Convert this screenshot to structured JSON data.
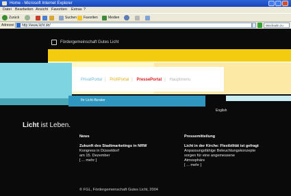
{
  "browser": {
    "title": "Home - Microsoft Internet Explorer",
    "menu": [
      "Datei",
      "Bearbeiten",
      "Ansicht",
      "Favoriten",
      "Extras",
      "?"
    ],
    "toolbar": {
      "back": "Zurück",
      "search": "Suchen",
      "favorites": "Favoriten",
      "media": "Medien"
    },
    "address_label": "Adresse",
    "url": "http://www.licht.de/",
    "search_box": "Wechseln zu"
  },
  "site": {
    "org_name": "Fördergemeinschaft Gutes Licht",
    "portals": [
      {
        "label": "PrivatPortal"
      },
      {
        "label": "ProfiPortal"
      },
      {
        "label": "PressePortal"
      },
      {
        "label": "Hauptmenu"
      }
    ],
    "separator": "|",
    "berater": "Ihr Licht-Berater",
    "english": "English",
    "tagline_bold": "Licht",
    "tagline_rest": " ist Leben.",
    "news": {
      "heading": "News",
      "title": "Zukunft des Stadtmarketings in NRW",
      "lines": [
        "Kongress in Düsseldorf",
        "am 15. Dezember",
        "[ ... mehr ]"
      ]
    },
    "press": {
      "heading": "Pressemitteilung",
      "title": "Licht in der Kirche: Flexibilität ist gefragt",
      "lines": [
        "Anpassungsfähige Beleuchtungskonzepte",
        "sorgen für eine angemessene",
        "Atmosphäre",
        "[ ... mehr ]"
      ]
    },
    "copyright": "© FGL, Fördergemeinschaft Gutes Licht, 2004"
  },
  "colors": {
    "background": "#0a0a0a",
    "yellow": "#f3cc10",
    "cream": "#fff7c8",
    "cyan": "#7ed4e0",
    "blue": "#2f97bf",
    "presse_red": "#e21a1a"
  }
}
